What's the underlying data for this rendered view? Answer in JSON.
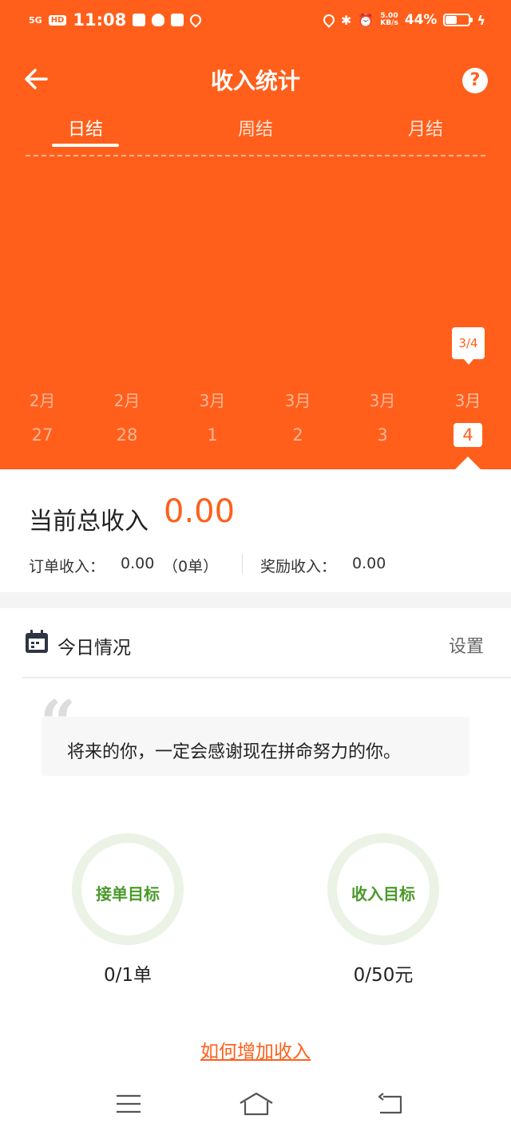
{
  "status_bar": {
    "network": "5G",
    "hd": "HD",
    "time": "11:08",
    "speed_value": "5.00",
    "speed_unit": "KB/s",
    "battery_pct": "44%",
    "battery_level": 0.44,
    "icons": [
      "signal-icon",
      "hd-icon",
      "sim-icon",
      "qq-icon",
      "mail-icon",
      "map-pin-icon",
      "location-icon",
      "bluetooth-icon",
      "alarm-icon",
      "battery-icon",
      "charging-icon"
    ]
  },
  "header": {
    "title": "收入统计",
    "help_label": "?",
    "tabs": [
      {
        "label": "日结",
        "active": true
      },
      {
        "label": "周结",
        "active": false
      },
      {
        "label": "月结",
        "active": false
      }
    ],
    "tooltip": "3/4",
    "dates": [
      {
        "month": "2月",
        "day": "27"
      },
      {
        "month": "2月",
        "day": "28"
      },
      {
        "month": "3月",
        "day": "1"
      },
      {
        "month": "3月",
        "day": "2"
      },
      {
        "month": "3月",
        "day": "3"
      },
      {
        "month": "3月",
        "day": "4",
        "active": true
      }
    ]
  },
  "summary": {
    "total_label": "当前总收入",
    "total_value": "0.00",
    "order_label": "订单收入：",
    "order_value": "0.00",
    "order_count": "（0单）",
    "bonus_label": "奖励收入：",
    "bonus_value": "0.00"
  },
  "today": {
    "title": "今日情况",
    "settings_label": "设置",
    "quote_mark": "“",
    "quote": "将来的你，一定会感谢现在拼命努力的你。",
    "goals": [
      {
        "label": "接单目标",
        "value": "0/1单"
      },
      {
        "label": "收入目标",
        "value": "0/50元"
      }
    ],
    "link": "如何增加收入"
  },
  "colors": {
    "brand": "#ff5f1b",
    "goal_ring": "#eaf3e5",
    "goal_text": "#4a9a2a"
  },
  "bottom_nav": [
    "menu-icon",
    "home-icon",
    "back-icon"
  ]
}
